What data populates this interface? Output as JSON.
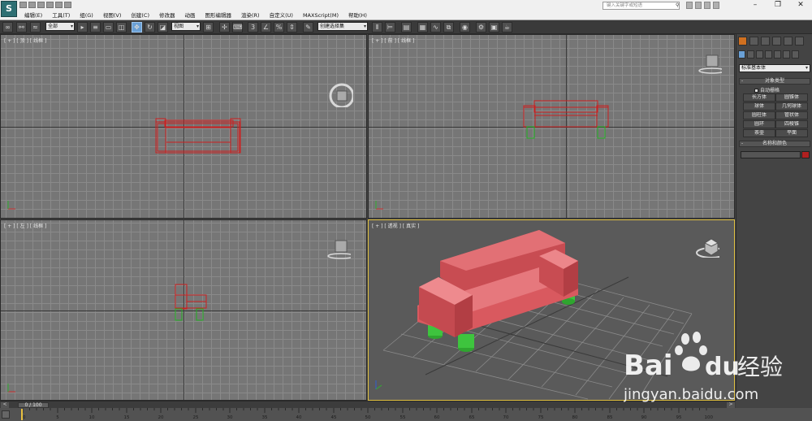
{
  "app": {
    "logo_text": "S"
  },
  "menu": [
    "编辑(E)",
    "工具(T)",
    "组(G)",
    "视图(V)",
    "创建(C)",
    "修改器",
    "动画",
    "图形编辑器",
    "渲染(R)",
    "自定义(U)",
    "MAXScript(M)",
    "帮助(H)"
  ],
  "search": {
    "placeholder": "键入关键字或短语"
  },
  "toolbar": {
    "selection_filter": "全部",
    "reference_coord": "视图",
    "named_selection": "创建选择集"
  },
  "viewports": {
    "top": {
      "label": "[ + ] [ 顶 ] [ 线框 ]"
    },
    "front": {
      "label": "[ + ] [ 前 ] [ 线框 ]"
    },
    "left": {
      "label": "[ + ] [ 左 ] [ 线框 ]"
    },
    "perspective": {
      "label": "[ + ] [ 透视 ] [ 真实 ]"
    }
  },
  "command_panel": {
    "subcategory": "标准基本体",
    "object_type": {
      "title": "对象类型",
      "autogrid": "自动栅格",
      "buttons": [
        "长方体",
        "圆锥体",
        "球体",
        "几何球体",
        "圆柱体",
        "管状体",
        "圆环",
        "四棱锥",
        "茶壶",
        "平面"
      ]
    },
    "name_color": {
      "title": "名称和颜色",
      "swatch_color": "#b02020"
    }
  },
  "time_slider": {
    "display": "0 / 100",
    "prev": "<",
    "next": ">"
  },
  "trackbar": {
    "ticks": [
      "0",
      "5",
      "10",
      "15",
      "20",
      "25",
      "30",
      "35",
      "40",
      "45",
      "50",
      "55",
      "60",
      "65",
      "70",
      "75",
      "80",
      "85",
      "90",
      "95",
      "100"
    ]
  },
  "watermark": {
    "brand": "Bai",
    "brand_suffix": "du",
    "brand_cn": "经验",
    "url": "jingyan.baidu.com"
  },
  "colors": {
    "sofa_wire": "#cc2020",
    "leg_wire": "#20b020",
    "sofa_shaded": "#d9595f",
    "leg_shaded": "#3ec43e",
    "active_border": "#e0c040"
  }
}
